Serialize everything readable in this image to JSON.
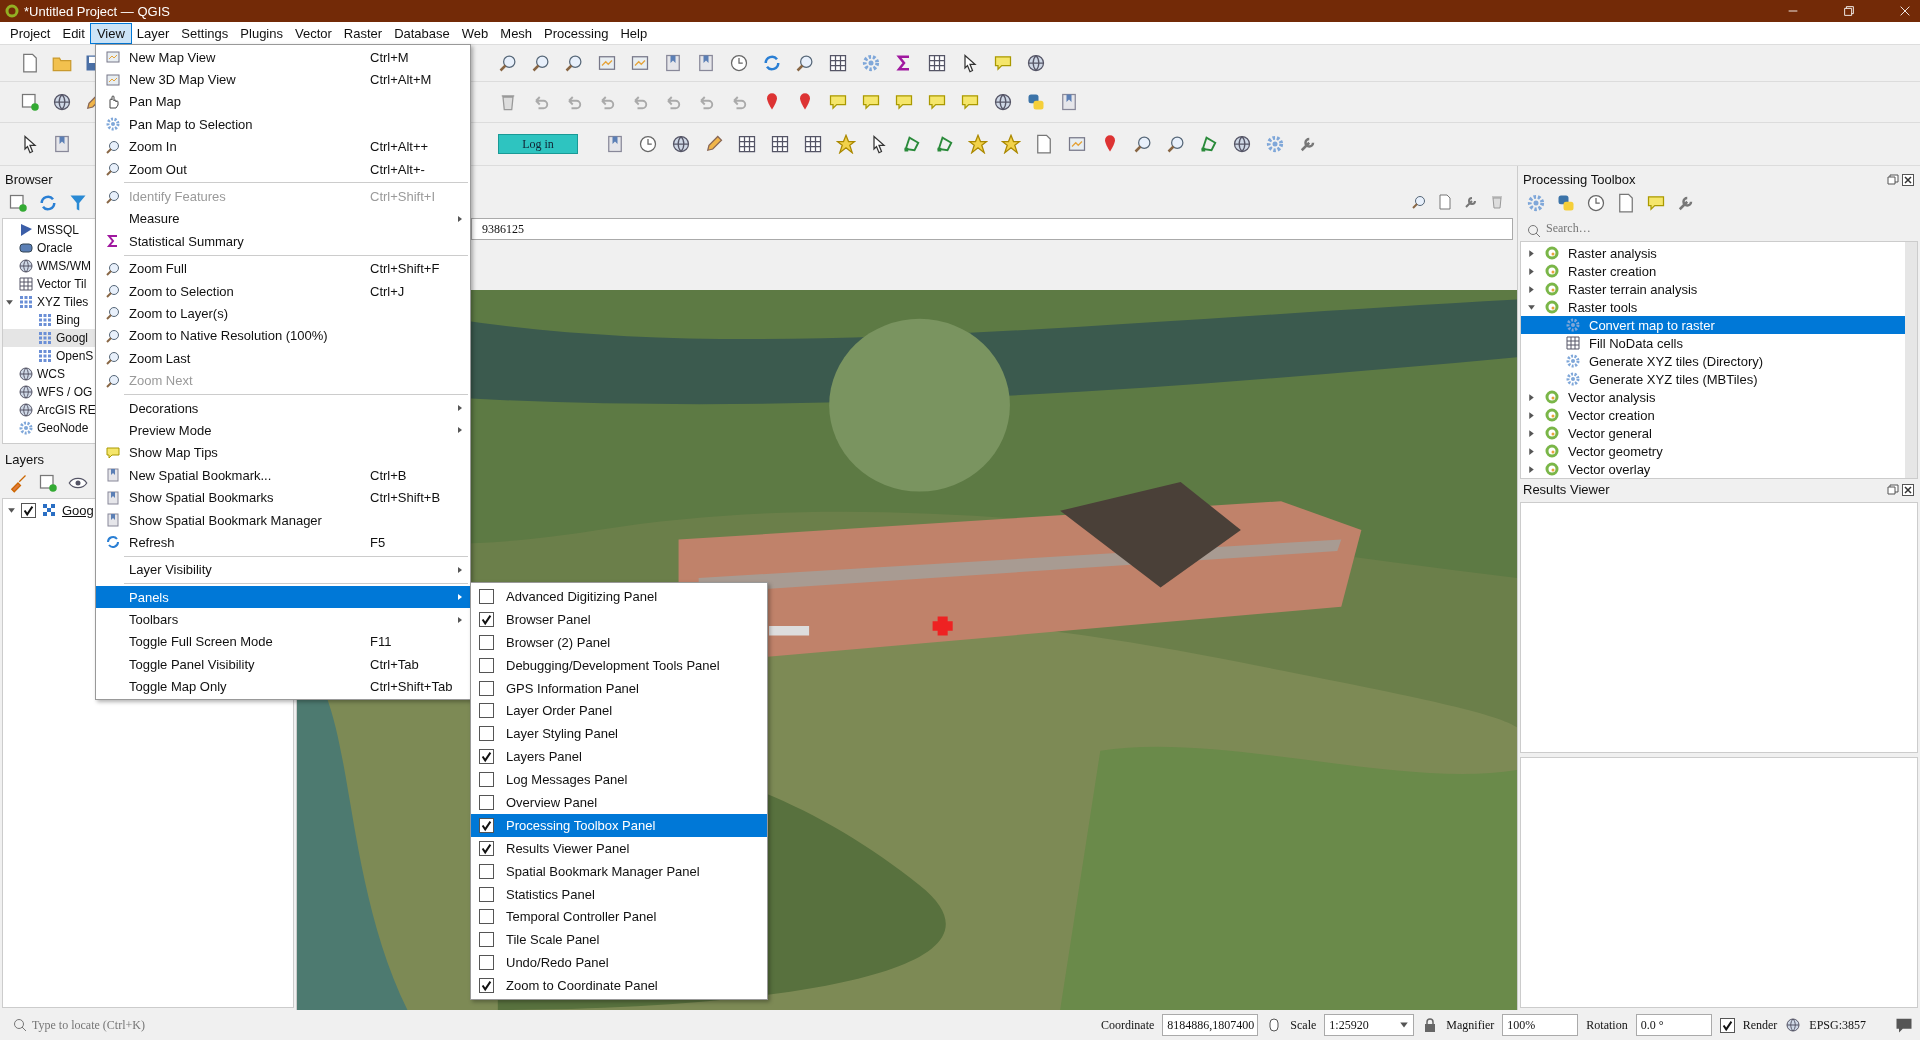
{
  "window": {
    "title": "*Untitled Project — QGIS"
  },
  "menu_bar": [
    {
      "label": "Project",
      "selected": false
    },
    {
      "label": "Edit",
      "selected": false
    },
    {
      "label": "View",
      "selected": true
    },
    {
      "label": "Layer",
      "selected": false
    },
    {
      "label": "Settings",
      "selected": false
    },
    {
      "label": "Plugins",
      "selected": false
    },
    {
      "label": "Vector",
      "selected": false
    },
    {
      "label": "Raster",
      "selected": false
    },
    {
      "label": "Database",
      "selected": false
    },
    {
      "label": "Web",
      "selected": false
    },
    {
      "label": "Mesh",
      "selected": false
    },
    {
      "label": "Processing",
      "selected": false
    },
    {
      "label": "Help",
      "selected": false
    }
  ],
  "toolbar": {
    "login_button": "Log in"
  },
  "browser_panel": {
    "title": "Browser",
    "items": [
      {
        "label": "MSSQL",
        "selected": false
      },
      {
        "label": "Oracle",
        "selected": false
      },
      {
        "label": "WMS/WM",
        "selected": false
      },
      {
        "label": "Vector Til",
        "selected": false
      },
      {
        "label": "XYZ Tiles",
        "expanded": true,
        "selected": false,
        "children": [
          {
            "label": "Bing",
            "selected": false
          },
          {
            "label": "Googl",
            "selected": true
          },
          {
            "label": "OpenS",
            "selected": false
          }
        ]
      },
      {
        "label": "WCS",
        "selected": false
      },
      {
        "label": "WFS / OG",
        "selected": false
      },
      {
        "label": "ArcGIS RE",
        "selected": false
      },
      {
        "label": "GeoNode",
        "selected": false
      }
    ]
  },
  "layers_panel": {
    "title": "Layers",
    "layers": [
      {
        "name": "Goog",
        "visible": true,
        "expanded": true
      }
    ]
  },
  "map_view": {
    "coordinate_field": "9386125"
  },
  "view_menu": [
    {
      "kind": "item",
      "label": "New Map View",
      "shortcut": "Ctrl+M",
      "disabled": false,
      "submenu": false,
      "selected": false
    },
    {
      "kind": "item",
      "label": "New 3D Map View",
      "shortcut": "Ctrl+Alt+M",
      "disabled": false,
      "submenu": false,
      "selected": false
    },
    {
      "kind": "item",
      "label": "Pan Map",
      "disabled": false,
      "submenu": false,
      "selected": false
    },
    {
      "kind": "item",
      "label": "Pan Map to Selection",
      "disabled": false,
      "submenu": false,
      "selected": false
    },
    {
      "kind": "item",
      "label": "Zoom In",
      "shortcut": "Ctrl+Alt++",
      "disabled": false,
      "submenu": false,
      "selected": false
    },
    {
      "kind": "item",
      "label": "Zoom Out",
      "shortcut": "Ctrl+Alt+-",
      "disabled": false,
      "submenu": false,
      "selected": false
    },
    {
      "kind": "separator"
    },
    {
      "kind": "item",
      "label": "Identify Features",
      "shortcut": "Ctrl+Shift+I",
      "disabled": true,
      "submenu": false,
      "selected": false
    },
    {
      "kind": "item",
      "label": "Measure",
      "disabled": false,
      "submenu": true,
      "selected": false
    },
    {
      "kind": "item",
      "label": "Statistical Summary",
      "disabled": false,
      "submenu": false,
      "selected": false
    },
    {
      "kind": "separator"
    },
    {
      "kind": "item",
      "label": "Zoom Full",
      "shortcut": "Ctrl+Shift+F",
      "disabled": false,
      "submenu": false,
      "selected": false
    },
    {
      "kind": "item",
      "label": "Zoom to Selection",
      "shortcut": "Ctrl+J",
      "disabled": false,
      "submenu": false,
      "selected": false
    },
    {
      "kind": "item",
      "label": "Zoom to Layer(s)",
      "disabled": false,
      "submenu": false,
      "selected": false
    },
    {
      "kind": "item",
      "label": "Zoom to Native Resolution (100%)",
      "disabled": false,
      "submenu": false,
      "selected": false
    },
    {
      "kind": "item",
      "label": "Zoom Last",
      "disabled": false,
      "submenu": false,
      "selected": false
    },
    {
      "kind": "item",
      "label": "Zoom Next",
      "disabled": true,
      "submenu": false,
      "selected": false
    },
    {
      "kind": "separator"
    },
    {
      "kind": "item",
      "label": "Decorations",
      "disabled": false,
      "submenu": true,
      "selected": false
    },
    {
      "kind": "item",
      "label": "Preview Mode",
      "disabled": false,
      "submenu": true,
      "selected": false
    },
    {
      "kind": "item",
      "label": "Show Map Tips",
      "disabled": false,
      "submenu": false,
      "selected": false
    },
    {
      "kind": "item",
      "label": "New Spatial Bookmark...",
      "shortcut": "Ctrl+B",
      "disabled": false,
      "submenu": false,
      "selected": false
    },
    {
      "kind": "item",
      "label": "Show Spatial Bookmarks",
      "shortcut": "Ctrl+Shift+B",
      "disabled": false,
      "submenu": false,
      "selected": false
    },
    {
      "kind": "item",
      "label": "Show Spatial Bookmark Manager",
      "disabled": false,
      "submenu": false,
      "selected": false
    },
    {
      "kind": "item",
      "label": "Refresh",
      "shortcut": "F5",
      "disabled": false,
      "submenu": false,
      "selected": false
    },
    {
      "kind": "separator"
    },
    {
      "kind": "item",
      "label": "Layer Visibility",
      "disabled": false,
      "submenu": true,
      "selected": false
    },
    {
      "kind": "separator"
    },
    {
      "kind": "item",
      "label": "Panels",
      "disabled": false,
      "submenu": true,
      "selected": true
    },
    {
      "kind": "item",
      "label": "Toolbars",
      "disabled": false,
      "submenu": true,
      "selected": false
    },
    {
      "kind": "item",
      "label": "Toggle Full Screen Mode",
      "shortcut": "F11",
      "disabled": false,
      "submenu": false,
      "selected": false
    },
    {
      "kind": "item",
      "label": "Toggle Panel Visibility",
      "shortcut": "Ctrl+Tab",
      "disabled": false,
      "submenu": false,
      "selected": false
    },
    {
      "kind": "item",
      "label": "Toggle Map Only",
      "shortcut": "Ctrl+Shift+Tab",
      "disabled": false,
      "submenu": false,
      "selected": false
    }
  ],
  "panels_submenu": [
    {
      "label": "Advanced Digitizing Panel",
      "checked": false,
      "selected": false
    },
    {
      "label": "Browser Panel",
      "checked": true,
      "selected": false
    },
    {
      "label": "Browser (2) Panel",
      "checked": false,
      "selected": false
    },
    {
      "label": "Debugging/Development Tools Panel",
      "checked": false,
      "selected": false
    },
    {
      "label": "GPS Information Panel",
      "checked": false,
      "selected": false
    },
    {
      "label": "Layer Order Panel",
      "checked": false,
      "selected": false
    },
    {
      "label": "Layer Styling Panel",
      "checked": false,
      "selected": false
    },
    {
      "label": "Layers Panel",
      "checked": true,
      "selected": false
    },
    {
      "label": "Log Messages Panel",
      "checked": false,
      "selected": false
    },
    {
      "label": "Overview Panel",
      "checked": false,
      "selected": false
    },
    {
      "label": "Processing Toolbox Panel",
      "checked": true,
      "selected": true
    },
    {
      "label": "Results Viewer Panel",
      "checked": true,
      "selected": false
    },
    {
      "label": "Spatial Bookmark Manager Panel",
      "checked": false,
      "selected": false
    },
    {
      "label": "Statistics Panel",
      "checked": false,
      "selected": false
    },
    {
      "label": "Temporal Controller Panel",
      "checked": false,
      "selected": false
    },
    {
      "label": "Tile Scale Panel",
      "checked": false,
      "selected": false
    },
    {
      "label": "Undo/Redo Panel",
      "checked": false,
      "selected": false
    },
    {
      "label": "Zoom to Coordinate Panel",
      "checked": true,
      "selected": false
    }
  ],
  "processing_toolbox": {
    "title": "Processing Toolbox",
    "search_placeholder": "Search…",
    "tree": [
      {
        "label": "Raster analysis",
        "expanded": false,
        "selected": false
      },
      {
        "label": "Raster creation",
        "expanded": false,
        "selected": false
      },
      {
        "label": "Raster terrain analysis",
        "expanded": false,
        "selected": false
      },
      {
        "label": "Raster tools",
        "expanded": true,
        "selected": false,
        "children": [
          {
            "label": "Convert map to raster",
            "selected": true
          },
          {
            "label": "Fill NoData cells",
            "selected": false
          },
          {
            "label": "Generate XYZ tiles (Directory)",
            "selected": false
          },
          {
            "label": "Generate XYZ tiles (MBTiles)",
            "selected": false
          }
        ]
      },
      {
        "label": "Vector analysis",
        "expanded": false,
        "selected": false
      },
      {
        "label": "Vector creation",
        "expanded": false,
        "selected": false
      },
      {
        "label": "Vector general",
        "expanded": false,
        "selected": false
      },
      {
        "label": "Vector geometry",
        "expanded": false,
        "selected": false
      },
      {
        "label": "Vector overlay",
        "expanded": false,
        "selected": false
      }
    ]
  },
  "results_viewer": {
    "title": "Results Viewer"
  },
  "status_bar": {
    "locate_placeholder": "Type to locate (Ctrl+K)",
    "coordinate_label": "Coordinate",
    "coordinate": "8184886,1807400",
    "scale_label": "Scale",
    "scale": "1:25920",
    "magnifier_label": "Magnifier",
    "magnifier": "100%",
    "rotation_label": "Rotation",
    "rotation": "0.0 °",
    "render_label": "Render",
    "render": true,
    "crs": "EPSG:3857"
  }
}
